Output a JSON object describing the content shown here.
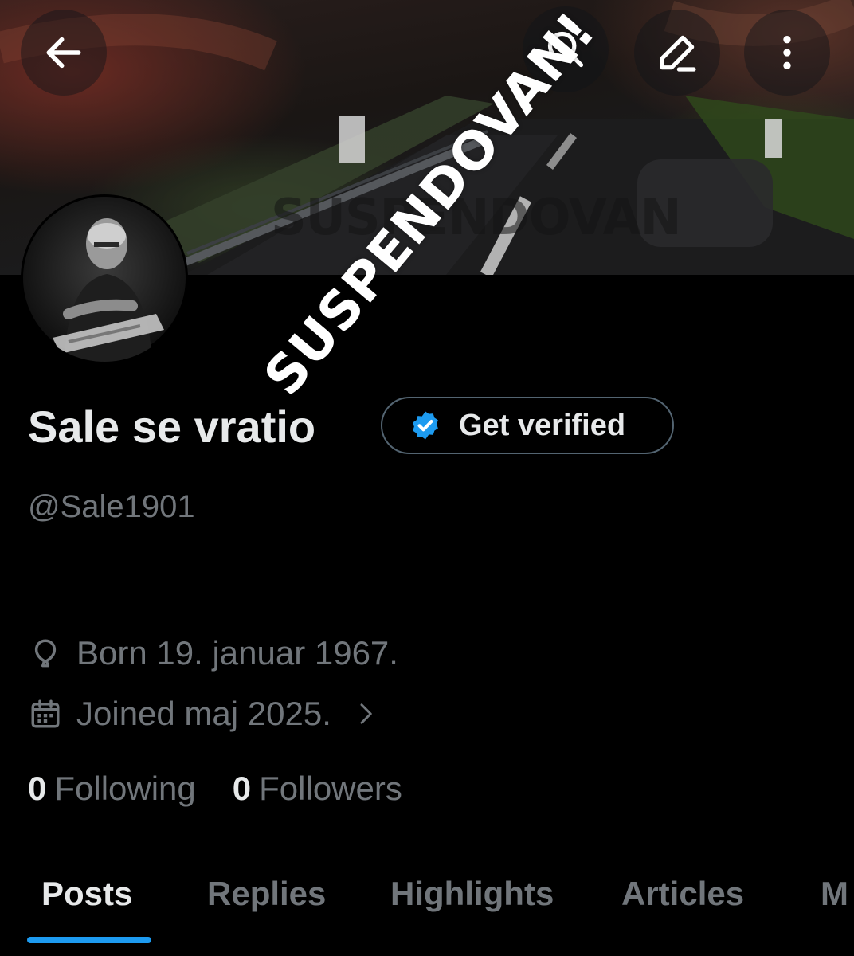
{
  "header": {
    "back_icon": "arrow-left-icon",
    "search_icon": "search-icon",
    "edit_icon": "edit-pencil-icon",
    "more_icon": "more-vertical-icon"
  },
  "banner": {
    "watermark_text": "SUSPENDOVAN"
  },
  "overlay": {
    "stamp_text": "SUSPENDOVAN!"
  },
  "profile": {
    "display_name": "Sale se vratio",
    "handle": "@Sale1901",
    "verify_button_label": "Get verified",
    "verify_badge_color": "#1d9bf0",
    "birth": "Born 19. januar 1967.",
    "joined": "Joined maj 2025.",
    "following_count": "0",
    "following_label": "Following",
    "followers_count": "0",
    "followers_label": "Followers"
  },
  "tabs": [
    {
      "label": "Posts",
      "active": true
    },
    {
      "label": "Replies",
      "active": false
    },
    {
      "label": "Highlights",
      "active": false
    },
    {
      "label": "Articles",
      "active": false
    },
    {
      "label": "M",
      "active": false
    }
  ],
  "colors": {
    "background": "#000000",
    "text_primary": "#e7e9ea",
    "text_secondary": "#71767b",
    "accent": "#1d9bf0",
    "border": "#536471"
  }
}
